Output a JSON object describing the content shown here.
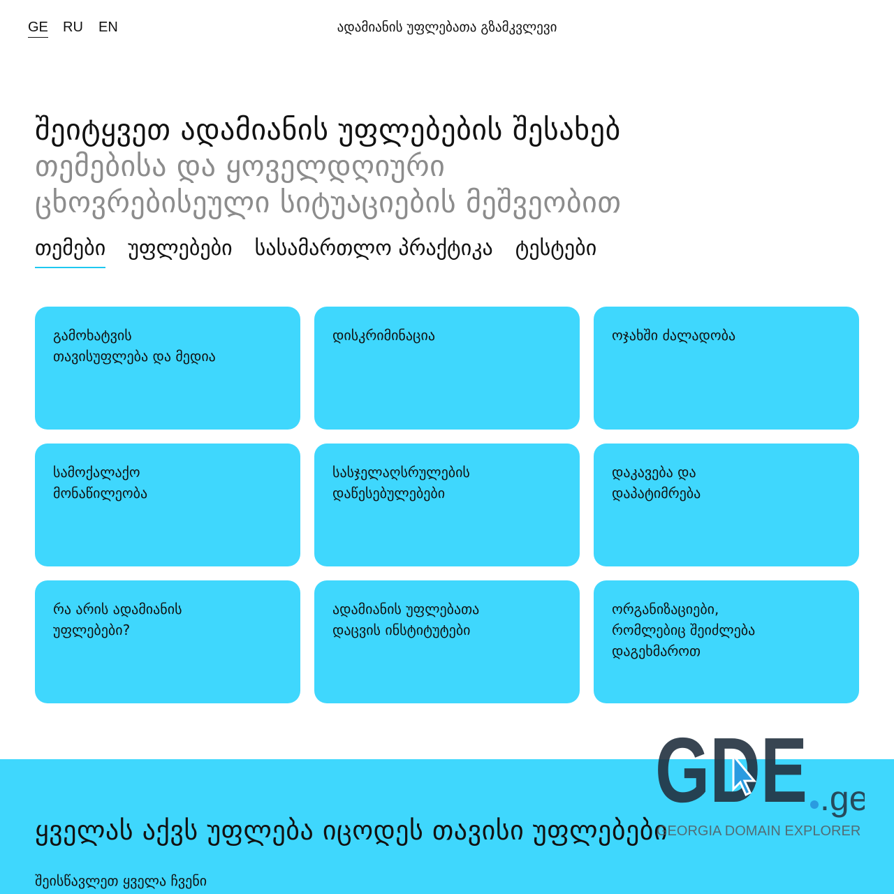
{
  "languages": [
    {
      "code": "GE",
      "active": true
    },
    {
      "code": "RU",
      "active": false
    },
    {
      "code": "EN",
      "active": false
    }
  ],
  "site_title": "ადამიანის უფლებათა გზამკვლევი",
  "hero": {
    "line1": "შეიტყვეთ ადამიანის უფლებების შესახებ",
    "line2": "თემებისა და ყოველდღიური",
    "line3": "ცხოვრებისეული სიტუაციების მეშვეობით"
  },
  "nav": {
    "items": [
      {
        "label": "თემები",
        "active": true
      },
      {
        "label": "უფლებები",
        "active": false
      },
      {
        "label": "სასამართლო პრაქტიკა",
        "active": false
      },
      {
        "label": "ტესტები",
        "active": false
      }
    ]
  },
  "topics": {
    "cards": [
      {
        "label": "გამოხატვის\nთავისუფლება და მედია"
      },
      {
        "label": "დისკრიმინაცია"
      },
      {
        "label": "ოჯახში ძალადობა"
      },
      {
        "label": "სამოქალაქო\nმონაწილეობა"
      },
      {
        "label": "სასჯელაღსრულების\nდაწესებულებები"
      },
      {
        "label": "დაკავება და\nდაპატიმრება"
      },
      {
        "label": "რა არის ადამიანის\nუფლებები?"
      },
      {
        "label": "ადამიანის უფლებათა\nდაცვის ინსტიტუტები"
      },
      {
        "label": "ორგანიზაციები,\nრომლებიც შეიძლება\nდაგეხმაროთ"
      }
    ]
  },
  "banner": {
    "title": "ყველას აქვს უფლება იცოდეს თავისი უფლებები",
    "subtitle": "შეისწავლეთ ყველა ჩვენი"
  },
  "watermark": {
    "logo_text": "GDE",
    "domain_suffix": ".ge",
    "caption": "GEORGIA DOMAIN EXPLORER"
  },
  "colors": {
    "accent": "#3fd7fd",
    "nav_underline": "#1ec8f0",
    "hero_secondary": "#8c8c8c",
    "text": "#111111"
  }
}
